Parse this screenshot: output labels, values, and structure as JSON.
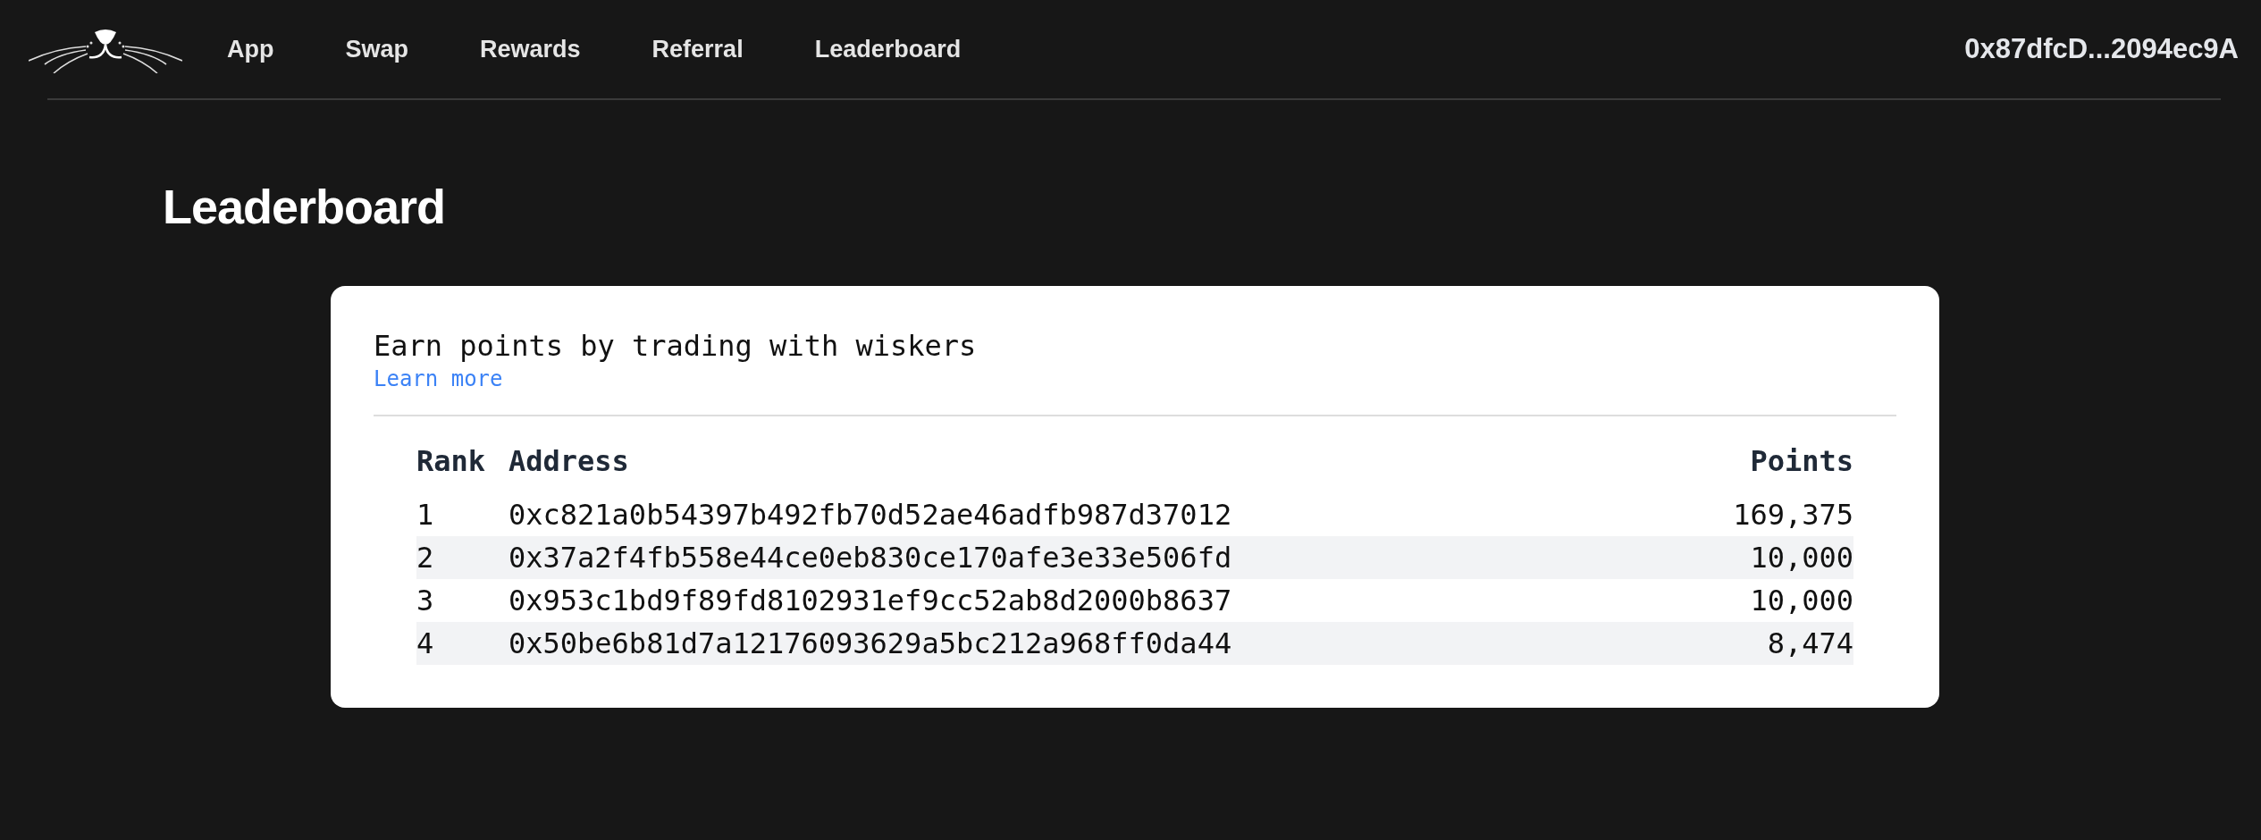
{
  "nav": {
    "links": [
      "App",
      "Swap",
      "Rewards",
      "Referral",
      "Leaderboard"
    ],
    "wallet": "0x87dfcD...2094ec9A"
  },
  "page_title": "Leaderboard",
  "card": {
    "heading": "Earn points by trading with wiskers",
    "link": "Learn more",
    "table": {
      "columns": [
        "Rank",
        "Address",
        "Points"
      ],
      "rows": [
        {
          "rank": "1",
          "address": "0xc821a0b54397b492fb70d52ae46adfb987d37012",
          "points": "169,375"
        },
        {
          "rank": "2",
          "address": "0x37a2f4fb558e44ce0eb830ce170afe3e33e506fd",
          "points": "10,000"
        },
        {
          "rank": "3",
          "address": "0x953c1bd9f89fd8102931ef9cc52ab8d2000b8637",
          "points": "10,000"
        },
        {
          "rank": "4",
          "address": "0x50be6b81d7a12176093629a5bc212a968ff0da44",
          "points": "8,474"
        }
      ]
    }
  }
}
